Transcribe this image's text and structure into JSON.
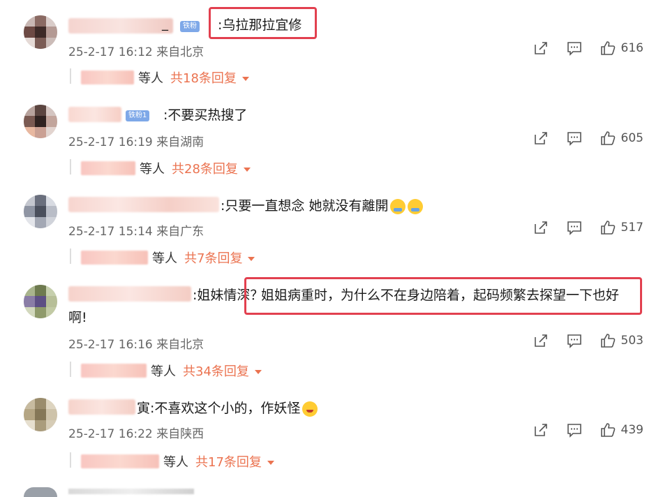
{
  "comments": [
    {
      "badge": "铁粉",
      "text": ":乌拉那拉宜修",
      "name_suffix": "_",
      "time": "25-2-17 16:12",
      "location": "来自北京",
      "likes": "616",
      "reply_deng": "等人",
      "reply_count": "共18条回复"
    },
    {
      "badge": "铁粉1",
      "text": ":不要买热搜了",
      "time": "25-2-17 16:19",
      "location": "来自湖南",
      "likes": "605",
      "reply_deng": "等人",
      "reply_count": "共28条回复"
    },
    {
      "text": ":只要一直想念 她就没有離開",
      "time": "25-2-17 15:14",
      "location": "来自广东",
      "likes": "517",
      "reply_deng": "等人",
      "reply_count": "共7条回复"
    },
    {
      "text_a": ":姐妹情深？",
      "text_b": "姐姐病重时，为什么不在身边陪着，起码频繁去探望一下也好",
      "text_c": "啊!",
      "time": "25-2-17 16:16",
      "location": "来自北京",
      "likes": "503",
      "reply_deng": "等人",
      "reply_count": "共34条回复"
    },
    {
      "name_suffix": "寅",
      "text": ":不喜欢这个小的，作妖怪",
      "time": "25-2-17 16:22",
      "location": "来自陕西",
      "likes": "439",
      "reply_deng": "等人",
      "reply_count": "共17条回复"
    }
  ],
  "icons": [
    "share-icon",
    "comment-icon",
    "like-icon"
  ]
}
